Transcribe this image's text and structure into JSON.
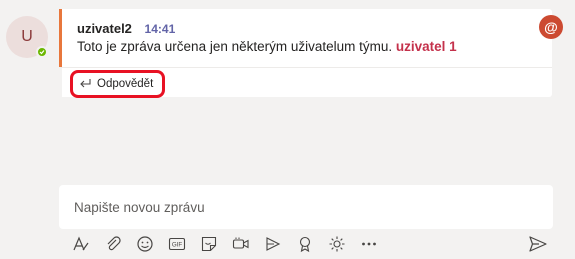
{
  "avatar": {
    "initial": "U"
  },
  "message": {
    "author": "uzivatel2",
    "time": "14:41",
    "text": "Toto je zpráva určena jen některým uživatelum týmu.",
    "mention": "uzivatel 1"
  },
  "reply": {
    "label": "Odpovědět"
  },
  "mention_badge": {
    "symbol": "@"
  },
  "compose": {
    "placeholder": "Napište novou zprávu"
  },
  "toolbar": {
    "gif_label": "GIF",
    "icons": [
      "format-icon",
      "attach-icon",
      "emoji-icon",
      "gif-icon",
      "sticker-icon",
      "meet-now-icon",
      "stream-icon",
      "praise-icon",
      "sun-icon",
      "more-options-icon"
    ],
    "send_icon": "send-icon"
  },
  "colors": {
    "accent": "#6264a7",
    "mention": "#c4314b",
    "highlight_border": "#e81123",
    "message_bar": "#e8773c",
    "badge": "#cc4a31",
    "presence": "#6bb700"
  }
}
